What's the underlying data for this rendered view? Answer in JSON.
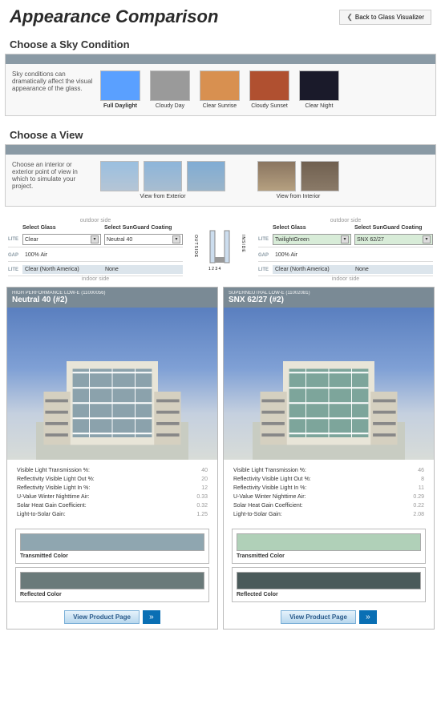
{
  "header": {
    "title": "Appearance Comparison",
    "back": "Back to Glass Visualizer"
  },
  "sky": {
    "title": "Choose a Sky Condition",
    "text": "Sky conditions can dramatically affect the visual appearance of the glass.",
    "items": [
      "Full Daylight",
      "Cloudy Day",
      "Clear Sunrise",
      "Cloudy Sunset",
      "Clear Night"
    ],
    "colors": [
      "#5aa0ff",
      "#9a9a9a",
      "#d89050",
      "#b05030",
      "#1a1a2a"
    ]
  },
  "view": {
    "title": "Choose a View",
    "text": "Choose an interior or exterior point of view in which to simulate your project.",
    "ext": "View from Exterior",
    "int": "View from Interior"
  },
  "config": {
    "outdoor": "outdoor side",
    "indoor": "indoor side",
    "hdr_glass": "Select Glass",
    "hdr_coat": "Select SunGuard Coating",
    "lite": "LITE",
    "gap": "GAP",
    "left": {
      "glass": "Clear",
      "coat": "Neutral 40",
      "gap": "100% Air",
      "glass2": "Clear (North America)",
      "coat2": "None"
    },
    "right": {
      "glass": "TwilightGreen",
      "coat": "SNX 62/27",
      "gap": "100% Air",
      "glass2": "Clear (North America)",
      "coat2": "None"
    },
    "diagram": {
      "outside": "OUTSIDE",
      "inside": "INSIDE",
      "nums": "1  2    3  4"
    }
  },
  "results": {
    "left": {
      "sub": "HIGH PERFORMANCE LOW-E (11000056)",
      "title": "Neutral 40 (#2)",
      "glass_tint": "#7a96a5",
      "specs": [
        [
          "Visible Light Transmission %:",
          "40"
        ],
        [
          "Reflectivity Visible Light Out %:",
          "20"
        ],
        [
          "Reflectivity Visible Light In %:",
          "12"
        ],
        [
          "U-Value Winter Nighttime Air:",
          "0.33"
        ],
        [
          "Solar Heat Gain Coefficient:",
          "0.32"
        ],
        [
          "Light-to-Solar Gain:",
          "1.25"
        ]
      ],
      "trans_color": "#8fa6b0",
      "refl_color": "#6a7a7a"
    },
    "right": {
      "sub": "SUPERNEUTRAL LOW-E (11002081)",
      "title": "SNX 62/27 (#2)",
      "glass_tint": "#6a9a90",
      "specs": [
        [
          "Visible Light Transmission %:",
          "46"
        ],
        [
          "Reflectivity Visible Light Out %:",
          "8"
        ],
        [
          "Reflectivity Visible Light In %:",
          "11"
        ],
        [
          "U-Value Winter Nighttime Air:",
          "0.29"
        ],
        [
          "Solar Heat Gain Coefficient:",
          "0.22"
        ],
        [
          "Light-to-Solar Gain:",
          "2.08"
        ]
      ],
      "trans_color": "#b0d0b8",
      "refl_color": "#4a5a5a"
    },
    "trans_lbl": "Transmitted Color",
    "refl_lbl": "Reflected Color",
    "btn": "View Product Page"
  }
}
